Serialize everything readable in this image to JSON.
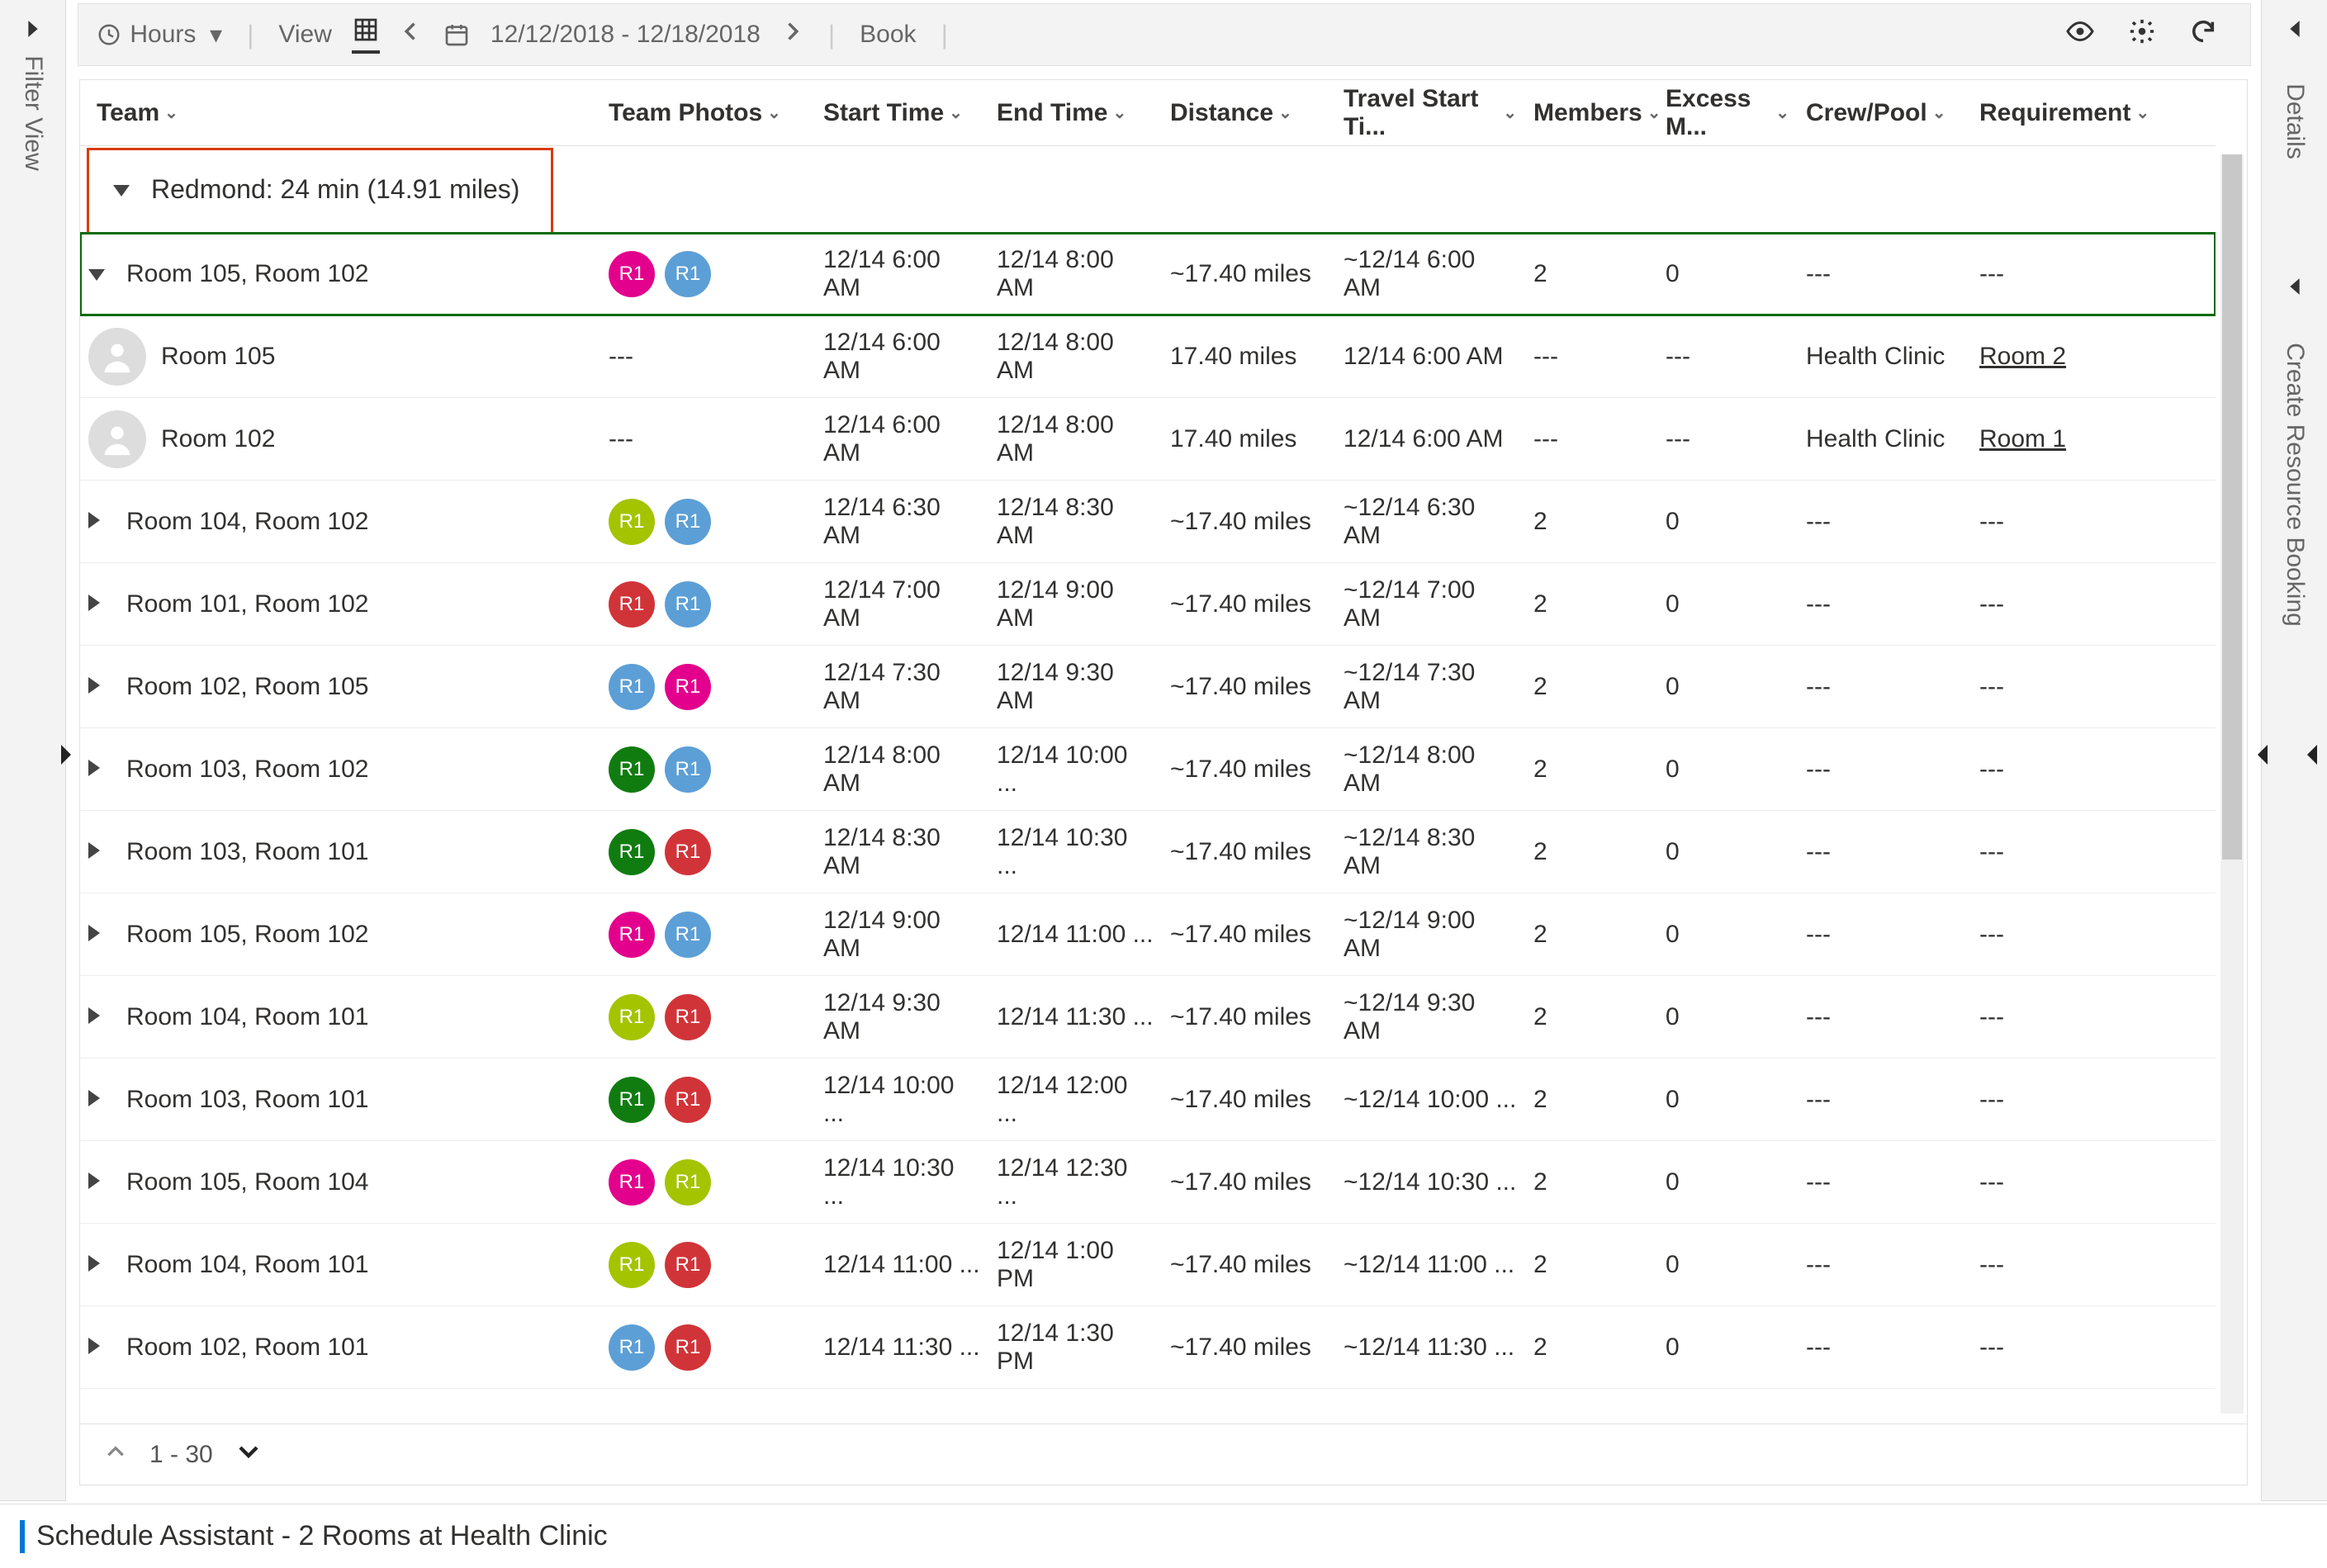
{
  "toolbar": {
    "hours_label": "Hours",
    "view_label": "View",
    "date_range": "12/12/2018 - 12/18/2018",
    "book_label": "Book"
  },
  "side": {
    "left_label": "Filter View",
    "right_label_1": "Details",
    "right_label_2": "Create Resource Booking"
  },
  "columns": {
    "team": "Team",
    "photos": "Team Photos",
    "start": "Start Time",
    "end": "End Time",
    "distance": "Distance",
    "travel_start": "Travel Start Ti...",
    "members": "Members",
    "excess": "Excess M...",
    "crew": "Crew/Pool",
    "requirement": "Requirement"
  },
  "colors": {
    "pink": "#e3008c",
    "blue": "#5c9fd6",
    "olive": "#a4c400",
    "red": "#d13438",
    "green": "#107c10"
  },
  "group": {
    "label": "Redmond: 24 min (14.91 miles)"
  },
  "rows": [
    {
      "type": "parent",
      "team": "Room 105, Room 102",
      "expanded": true,
      "highlight": true,
      "badges": [
        "pink",
        "blue"
      ],
      "photos_text": "",
      "start": "12/14 6:00 AM",
      "end": "12/14 8:00 AM",
      "distance": "~17.40 miles",
      "travel_start": "~12/14 6:00 AM",
      "members": "2",
      "excess": "0",
      "crew": "---",
      "requirement": "---"
    },
    {
      "type": "child",
      "team": "Room 105",
      "photos_text": "---",
      "start": "12/14 6:00 AM",
      "end": "12/14 8:00 AM",
      "distance": "17.40 miles",
      "travel_start": "12/14 6:00 AM",
      "members": "---",
      "excess": "---",
      "crew": "Health Clinic",
      "requirement": "Room 2",
      "req_link": true
    },
    {
      "type": "child",
      "team": "Room 102",
      "photos_text": "---",
      "start": "12/14 6:00 AM",
      "end": "12/14 8:00 AM",
      "distance": "17.40 miles",
      "travel_start": "12/14 6:00 AM",
      "members": "---",
      "excess": "---",
      "crew": "Health Clinic",
      "requirement": "Room 1",
      "req_link": true
    },
    {
      "type": "parent",
      "team": "Room 104, Room 102",
      "badges": [
        "olive",
        "blue"
      ],
      "start": "12/14 6:30 AM",
      "end": "12/14 8:30 AM",
      "distance": "~17.40 miles",
      "travel_start": "~12/14 6:30 AM",
      "members": "2",
      "excess": "0",
      "crew": "---",
      "requirement": "---"
    },
    {
      "type": "parent",
      "team": "Room 101, Room 102",
      "badges": [
        "red",
        "blue"
      ],
      "start": "12/14 7:00 AM",
      "end": "12/14 9:00 AM",
      "distance": "~17.40 miles",
      "travel_start": "~12/14 7:00 AM",
      "members": "2",
      "excess": "0",
      "crew": "---",
      "requirement": "---"
    },
    {
      "type": "parent",
      "team": "Room 102, Room 105",
      "badges": [
        "blue",
        "pink"
      ],
      "start": "12/14 7:30 AM",
      "end": "12/14 9:30 AM",
      "distance": "~17.40 miles",
      "travel_start": "~12/14 7:30 AM",
      "members": "2",
      "excess": "0",
      "crew": "---",
      "requirement": "---"
    },
    {
      "type": "parent",
      "team": "Room 103, Room 102",
      "badges": [
        "green",
        "blue"
      ],
      "start": "12/14 8:00 AM",
      "end": "12/14 10:00 ...",
      "distance": "~17.40 miles",
      "travel_start": "~12/14 8:00 AM",
      "members": "2",
      "excess": "0",
      "crew": "---",
      "requirement": "---"
    },
    {
      "type": "parent",
      "team": "Room 103, Room 101",
      "badges": [
        "green",
        "red"
      ],
      "start": "12/14 8:30 AM",
      "end": "12/14 10:30 ...",
      "distance": "~17.40 miles",
      "travel_start": "~12/14 8:30 AM",
      "members": "2",
      "excess": "0",
      "crew": "---",
      "requirement": "---"
    },
    {
      "type": "parent",
      "team": "Room 105, Room 102",
      "badges": [
        "pink",
        "blue"
      ],
      "start": "12/14 9:00 AM",
      "end": "12/14 11:00 ...",
      "distance": "~17.40 miles",
      "travel_start": "~12/14 9:00 AM",
      "members": "2",
      "excess": "0",
      "crew": "---",
      "requirement": "---"
    },
    {
      "type": "parent",
      "team": "Room 104, Room 101",
      "badges": [
        "olive",
        "red"
      ],
      "start": "12/14 9:30 AM",
      "end": "12/14 11:30 ...",
      "distance": "~17.40 miles",
      "travel_start": "~12/14 9:30 AM",
      "members": "2",
      "excess": "0",
      "crew": "---",
      "requirement": "---"
    },
    {
      "type": "parent",
      "team": "Room 103, Room 101",
      "badges": [
        "green",
        "red"
      ],
      "start": "12/14 10:00 ...",
      "end": "12/14 12:00 ...",
      "distance": "~17.40 miles",
      "travel_start": "~12/14 10:00 ...",
      "members": "2",
      "excess": "0",
      "crew": "---",
      "requirement": "---"
    },
    {
      "type": "parent",
      "team": "Room 105, Room 104",
      "badges": [
        "pink",
        "olive"
      ],
      "start": "12/14 10:30 ...",
      "end": "12/14 12:30 ...",
      "distance": "~17.40 miles",
      "travel_start": "~12/14 10:30 ...",
      "members": "2",
      "excess": "0",
      "crew": "---",
      "requirement": "---"
    },
    {
      "type": "parent",
      "team": "Room 104, Room 101",
      "badges": [
        "olive",
        "red"
      ],
      "start": "12/14 11:00 ...",
      "end": "12/14 1:00 PM",
      "distance": "~17.40 miles",
      "travel_start": "~12/14 11:00 ...",
      "members": "2",
      "excess": "0",
      "crew": "---",
      "requirement": "---"
    },
    {
      "type": "parent",
      "team": "Room 102, Room 101",
      "badges": [
        "blue",
        "red"
      ],
      "start": "12/14 11:30 ...",
      "end": "12/14 1:30 PM",
      "distance": "~17.40 miles",
      "travel_start": "~12/14 11:30 ...",
      "members": "2",
      "excess": "0",
      "crew": "---",
      "requirement": "---"
    }
  ],
  "pager": {
    "range": "1 - 30"
  },
  "status": "Schedule Assistant - 2 Rooms at Health Clinic",
  "badge_text": "R1"
}
